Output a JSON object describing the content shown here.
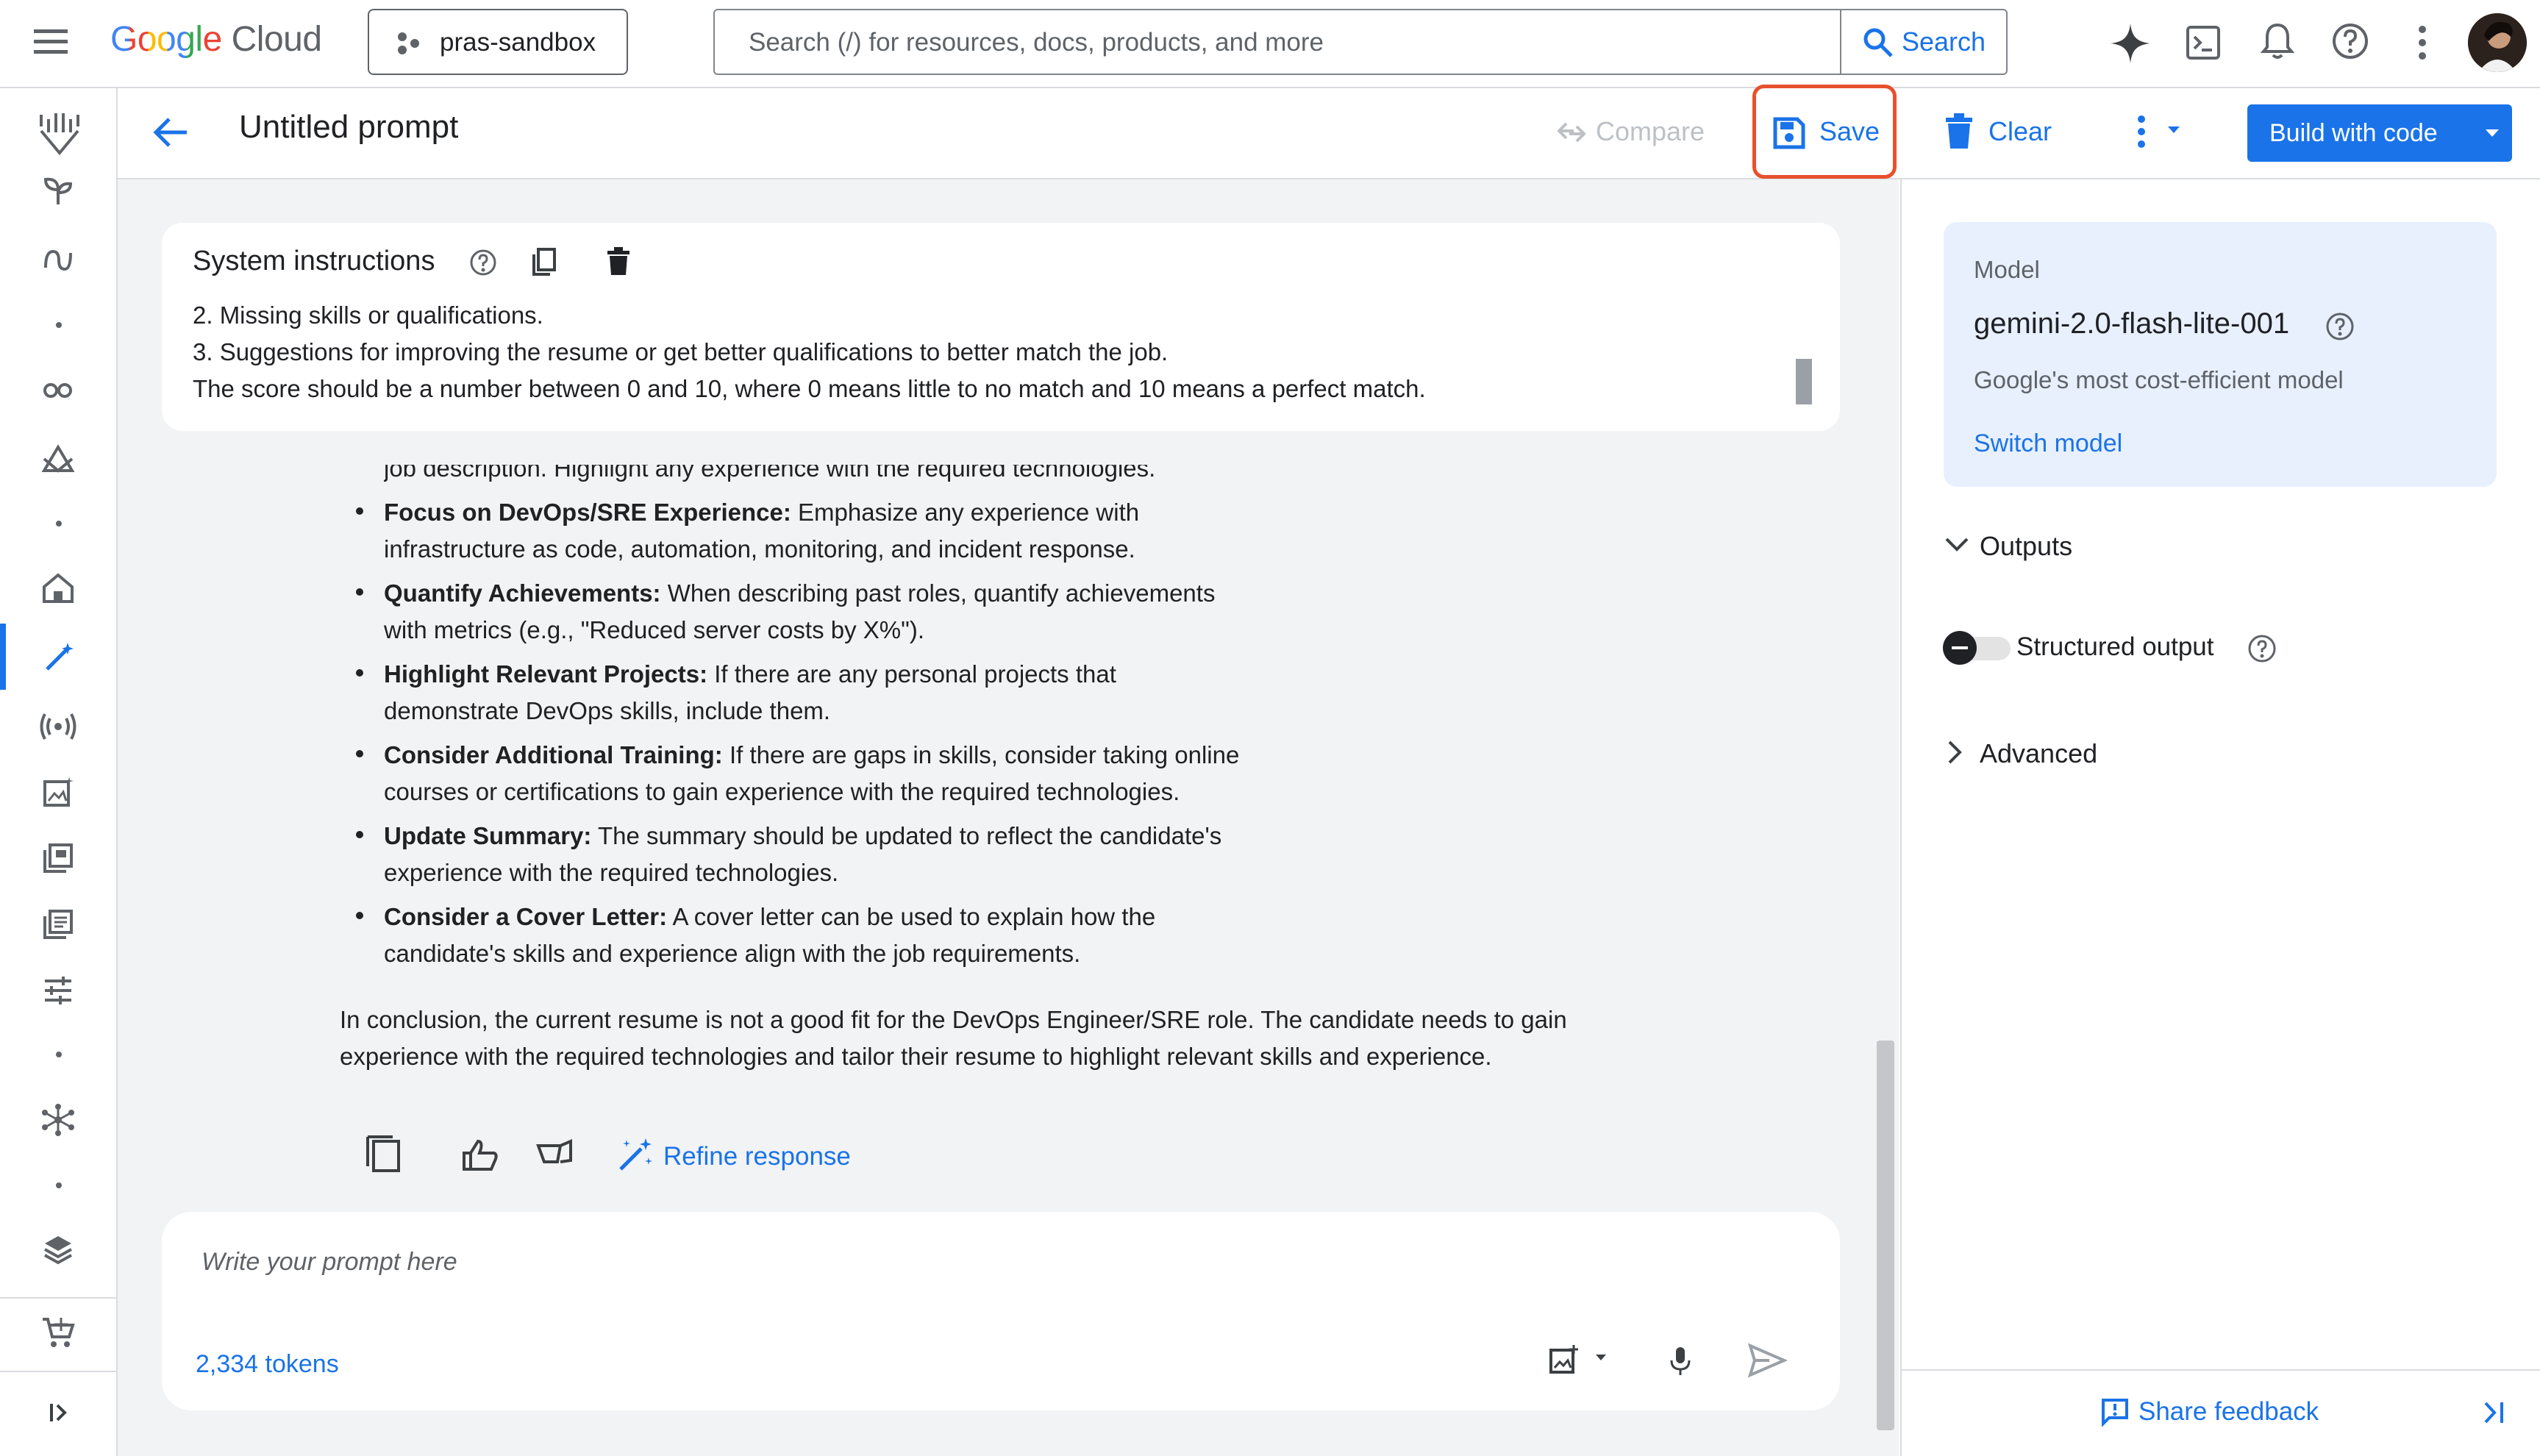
{
  "topbar": {
    "logo_google": "Google",
    "logo_cloud": "Cloud",
    "project": "pras-sandbox",
    "search_placeholder": "Search (/) for resources, docs, products, and more",
    "search_button": "Search"
  },
  "header": {
    "title": "Untitled prompt",
    "compare": "Compare",
    "save": "Save",
    "clear": "Clear",
    "build": "Build with code"
  },
  "system": {
    "title": "System instructions",
    "lines": [
      "2. Missing skills or qualifications.",
      "3. Suggestions for improving the resume or get better qualifications to better match the job.",
      "The score should be a number between 0 and 10, where 0 means little to no match and 10 means a perfect match."
    ]
  },
  "response": {
    "partial_line": "job description. Highlight any experience with the required technologies.",
    "bullets": [
      {
        "bold": "Focus on DevOps/SRE Experience:",
        "text": " Emphasize any experience with",
        "cont": "infrastructure as code, automation, monitoring, and incident response."
      },
      {
        "bold": "Quantify Achievements:",
        "text": " When describing past roles, quantify achievements",
        "cont": "with metrics (e.g., \"Reduced server costs by X%\")."
      },
      {
        "bold": "Highlight Relevant Projects:",
        "text": " If there are any personal projects that",
        "cont": "demonstrate DevOps skills, include them."
      },
      {
        "bold": "Consider Additional Training:",
        "text": " If there are gaps in skills, consider taking online",
        "cont": "courses or certifications to gain experience with the required technologies."
      },
      {
        "bold": "Update Summary:",
        "text": " The summary should be updated to reflect the candidate's",
        "cont": "experience with the required technologies."
      },
      {
        "bold": "Consider a Cover Letter:",
        "text": " A cover letter can be used to explain how the",
        "cont": "candidate's skills and experience align with the job requirements."
      }
    ],
    "conclusion": [
      "In conclusion, the current resume is not a good fit for the DevOps Engineer/SRE role. The candidate needs to gain",
      "experience with the required technologies and tailor their resume to highlight relevant skills and experience."
    ],
    "refine": "Refine response"
  },
  "prompt": {
    "placeholder": "Write your prompt here",
    "tokens": "2,334 tokens"
  },
  "right": {
    "model_label": "Model",
    "model_name": "gemini-2.0-flash-lite-001",
    "model_desc": "Google's most cost-efficient model",
    "switch_model": "Switch model",
    "outputs": "Outputs",
    "structured_output": "Structured output",
    "advanced": "Advanced",
    "share_feedback": "Share feedback"
  },
  "colors": {
    "accent": "#1a73e8",
    "highlight_frame": "#e8502d",
    "model_card_bg": "#e8f0fe"
  },
  "icons": [
    "menu-icon",
    "project-icon",
    "search-icon",
    "gemini-icon",
    "cloud-shell-icon",
    "bell-icon",
    "help-icon",
    "more-vert-icon",
    "avatar",
    "back-arrow-icon",
    "compare-icon",
    "save-icon",
    "trash-icon",
    "chevron-down-icon",
    "copy-icon",
    "thumb-up-icon",
    "thumb-down-icon",
    "refine-icon",
    "add-media-icon",
    "mic-icon",
    "send-icon",
    "feedback-icon",
    "collapse-panel-icon",
    "expand-nav-icon"
  ]
}
